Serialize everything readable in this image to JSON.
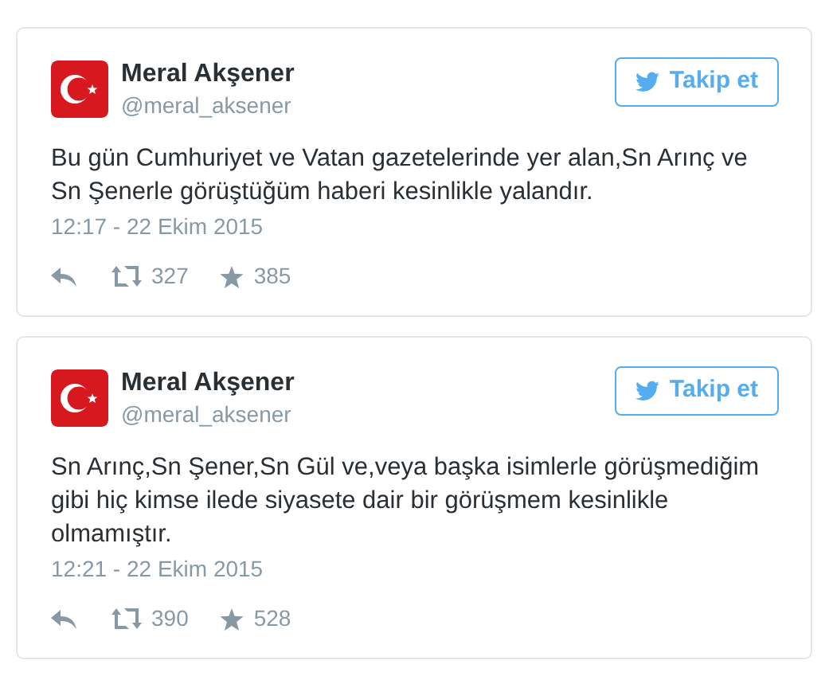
{
  "tweets": [
    {
      "name": "Meral Akşener",
      "handle": "@meral_aksener",
      "follow": "Takip et",
      "text": "Bu gün Cumhuriyet ve Vatan gazetelerinde yer alan,Sn Arınç ve Sn Şenerle görüştüğüm haberi kesinlikle yalandır.",
      "time": "12:17 - 22 Ekim 2015",
      "retweets": "327",
      "favorites": "385"
    },
    {
      "name": "Meral Akşener",
      "handle": "@meral_aksener",
      "follow": "Takip et",
      "text": "Sn Arınç,Sn Şener,Sn Gül ve,veya başka isimlerle görüşmediğim gibi hiç kimse ilede siyasete dair bir görüşmem kesinlikle olmamıştır.",
      "time": "12:21 - 22 Ekim 2015",
      "retweets": "390",
      "favorites": "528"
    }
  ]
}
